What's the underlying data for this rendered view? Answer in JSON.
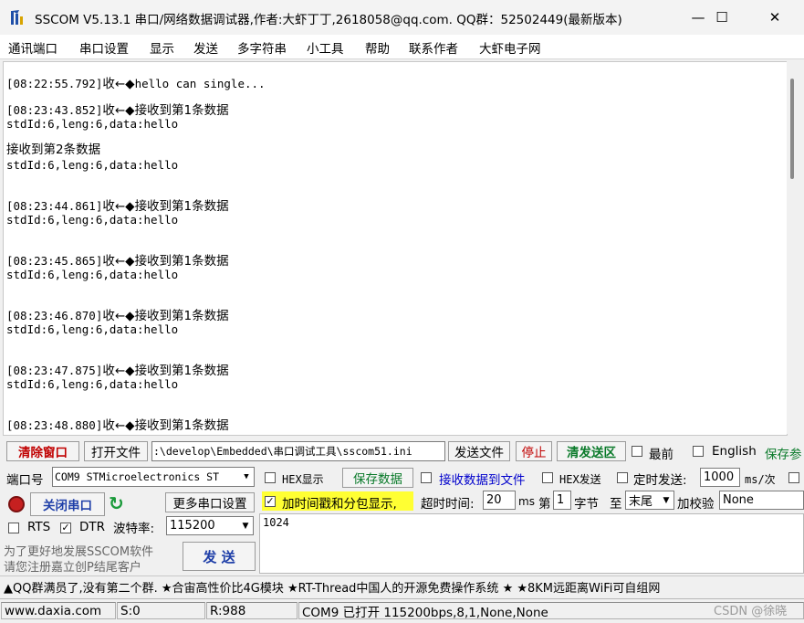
{
  "window": {
    "title": "SSCOM V5.13.1 串口/网络数据调试器,作者:大虾丁丁,2618058@qq.com. QQ群：52502449(最新版本)",
    "minimize": "—",
    "maximize": "☐",
    "close": "✕"
  },
  "menu": [
    "通讯端口",
    "串口设置",
    "显示",
    "发送",
    "多字符串",
    "小工具",
    "帮助",
    "联系作者",
    "大虾电子网"
  ],
  "receive_log": [
    {
      "ts": "[08:22:55.792]",
      "dir": "收←◆",
      "msg": "hello can single...",
      "details": []
    },
    {
      "ts": "[08:23:43.852]",
      "dir": "收←◆",
      "msg": "接收到第1条数据",
      "details": [
        "stdId:6,leng:6,data:hello",
        "",
        "接收到第2条数据",
        "stdId:6,leng:6,data:hello"
      ]
    },
    {
      "ts": "[08:23:44.861]",
      "dir": "收←◆",
      "msg": "接收到第1条数据",
      "details": [
        "stdId:6,leng:6,data:hello"
      ]
    },
    {
      "ts": "[08:23:45.865]",
      "dir": "收←◆",
      "msg": "接收到第1条数据",
      "details": [
        "stdId:6,leng:6,data:hello"
      ]
    },
    {
      "ts": "[08:23:46.870]",
      "dir": "收←◆",
      "msg": "接收到第1条数据",
      "details": [
        "stdId:6,leng:6,data:hello"
      ]
    },
    {
      "ts": "[08:23:47.875]",
      "dir": "收←◆",
      "msg": "接收到第1条数据",
      "details": [
        "stdId:6,leng:6,data:hello"
      ]
    },
    {
      "ts": "[08:23:48.880]",
      "dir": "收←◆",
      "msg": "接收到第1条数据",
      "details": []
    }
  ],
  "toolbar": {
    "clear_window": "清除窗口",
    "open_file": "打开文件",
    "file_path": ":\\develop\\Embedded\\串口调试工具\\sscom51.ini",
    "send_file": "发送文件",
    "stop": "停止",
    "clear_send": "清发送区",
    "topmost": "最前",
    "english": "English",
    "save_params": "保存参"
  },
  "port": {
    "port_label": "端口号",
    "port_value": "COM9 STMicroelectronics ST",
    "close_port": "关闭串口",
    "more_settings": "更多串口设置",
    "rts": "RTS",
    "dtr": "DTR",
    "baud_label": "波特率:",
    "baud_value": "115200",
    "promo_line1": "为了更好地发展SSCOM软件",
    "promo_line2": "请您注册嘉立创P结尾客户",
    "send_button": "发 送"
  },
  "options": {
    "hex_display": "HEX显示",
    "save_data": "保存数据",
    "recv_to_file": "接收数据到文件",
    "hex_send": "HEX发送",
    "timed_send": "定时发送:",
    "period_value": "1000",
    "period_unit": "ms/次",
    "add_timestamp": "加时间戳和分包显示,",
    "timeout_label": "超时时间:",
    "timeout_value": "20",
    "timeout_unit": "ms",
    "byte_prefix": "第",
    "byte_value": "1",
    "byte_suffix": "字节",
    "to_label": "至",
    "to_value": "末尾",
    "checksum_label": "加校验",
    "checksum_value": "None"
  },
  "send_area": {
    "text": "1024"
  },
  "ticker": "▲QQ群满员了,没有第二个群. ★合宙高性价比4G模块 ★RT-Thread中国人的开源免费操作系统 ★ ★8KM远距离WiFi可自组网",
  "status": {
    "website": "www.daxia.com",
    "sent": "S:0",
    "received": "R:988",
    "port_status": "COM9 已打开  115200bps,8,1,None,None"
  },
  "watermark": "CSDN @徐晓",
  "colors": {
    "highlight_yellow": "#ffff33",
    "red_text": "#c00000",
    "green_text": "#0a7a2a",
    "link_blue": "#0000cc"
  }
}
